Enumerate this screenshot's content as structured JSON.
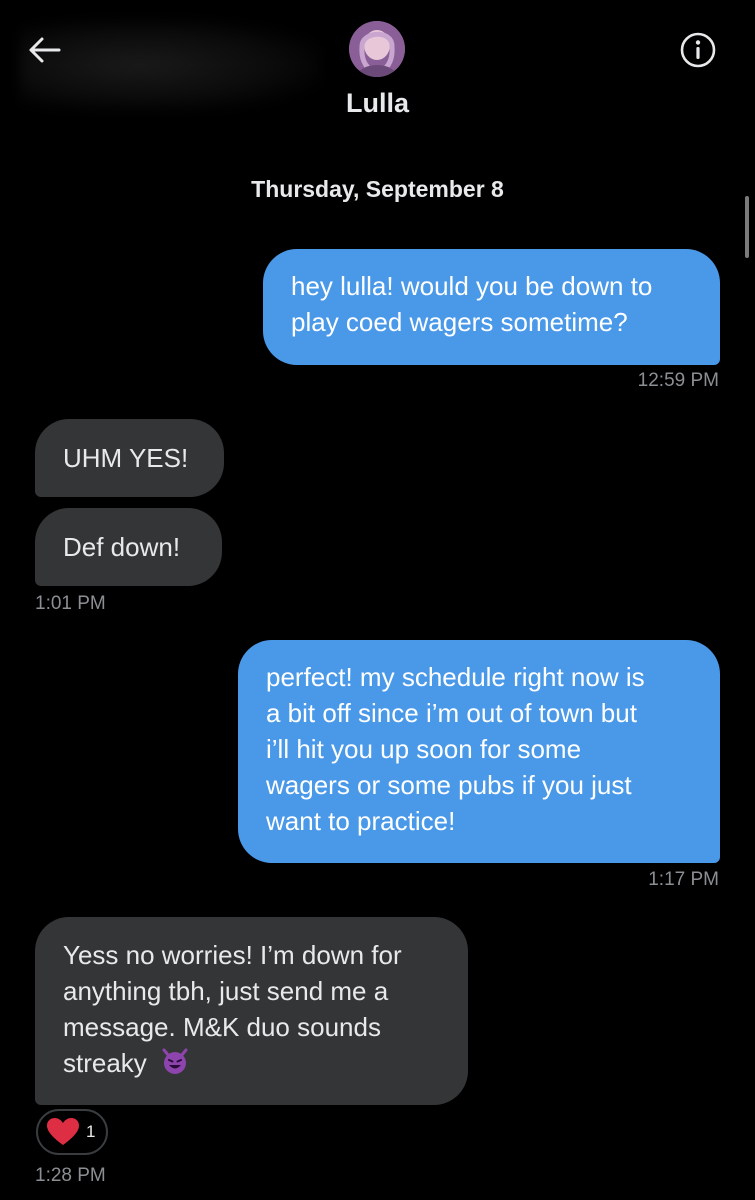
{
  "header": {
    "back_icon": "arrow-left-icon",
    "info_icon": "info-circle-icon",
    "contact_name": "Lulla"
  },
  "conversation": {
    "date_separator": "Thursday, September 8",
    "messages": [
      {
        "direction": "outgoing",
        "text_lines": [
          "hey lulla! would you be down to",
          "play coed wagers sometime?"
        ]
      },
      {
        "direction": "outgoing_timestamp",
        "time": "12:59 PM"
      },
      {
        "direction": "incoming",
        "text": "UHM YES!"
      },
      {
        "direction": "incoming",
        "text": "Def down!"
      },
      {
        "direction": "incoming_timestamp",
        "time": "1:01 PM"
      },
      {
        "direction": "outgoing",
        "text_lines": [
          "perfect! my schedule right now is",
          "a bit off since i’m out of town but",
          "i’ll hit you up soon for some",
          "wagers or some pubs if you just",
          "want to practice!"
        ]
      },
      {
        "direction": "outgoing_timestamp",
        "time": "1:17 PM"
      },
      {
        "direction": "incoming",
        "text_lines": [
          "Yess no worries! I’m down for",
          "anything tbh, just send me a",
          "message. M&K duo sounds",
          "streaky"
        ],
        "emoji": "smiling-imp-emoji"
      },
      {
        "direction": "incoming_timestamp",
        "time": "1:28 PM"
      }
    ],
    "reaction": {
      "emoji": "red-heart-emoji",
      "count": "1"
    }
  },
  "colors": {
    "background": "#000000",
    "outgoing_bubble": "#4a99e9",
    "incoming_bubble": "#333537",
    "timestamp": "#8b8f93",
    "text": "#e7e9ea"
  }
}
